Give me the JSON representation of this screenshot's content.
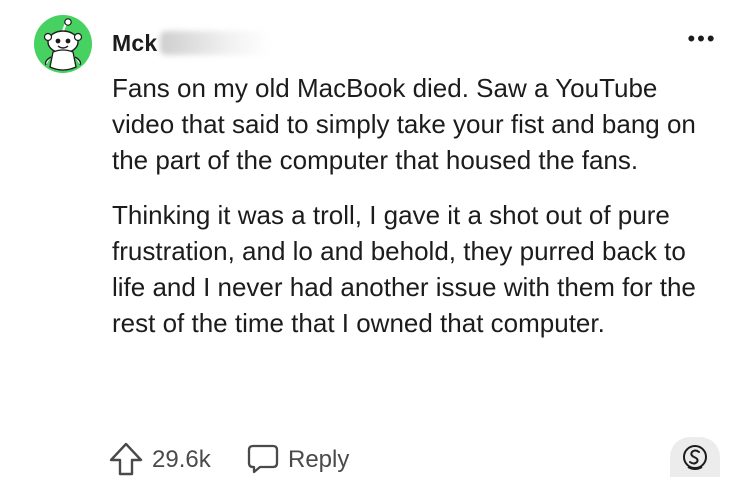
{
  "comment": {
    "username": "Mck",
    "more_label": "•••",
    "paragraphs": [
      "Fans on my old MacBook died. Saw a YouTube video that said to simply take your fist and bang on the part of the computer that housed the fans.",
      "Thinking it was a troll, I gave it a shot out of pure frustration, and lo and behold, they purred back to life and I never had another issue with them for the rest of the time that I owned that computer."
    ],
    "score": "29.6k",
    "reply_label": "Reply"
  },
  "icons": {
    "avatar": "snoo-avatar-icon",
    "more": "more-options-icon",
    "upvote": "upvote-arrow-icon",
    "reply": "speech-bubble-icon",
    "award": "award-icon"
  },
  "colors": {
    "avatar_green": "#46d160",
    "text": "#1c1c1c",
    "muted": "#4a4a4a"
  }
}
